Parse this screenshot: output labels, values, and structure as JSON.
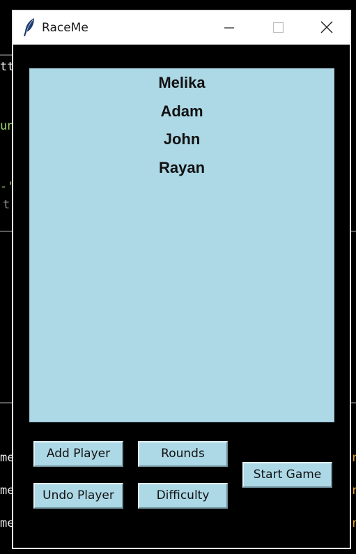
{
  "window": {
    "title": "RaceMe",
    "icon": "feather-icon",
    "controls": {
      "minimize": "minimize-icon",
      "maximize": "maximize-icon",
      "close": "close-icon"
    }
  },
  "players": {
    "items": [
      "Melika",
      "Adam",
      "John",
      "Rayan"
    ],
    "bg_color": "#add8e6"
  },
  "buttons": {
    "add_player": "Add Player",
    "undo_player": "Undo Player",
    "rounds": "Rounds",
    "difficulty": "Difficulty",
    "start_game": "Start Game"
  },
  "background_editor": {
    "fragments": [
      "tt",
      "un",
      "-'",
      "t.",
      "me",
      "me",
      "me"
    ]
  }
}
